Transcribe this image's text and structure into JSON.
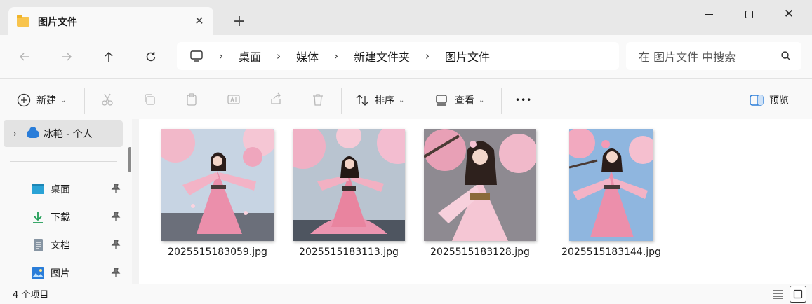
{
  "window": {
    "tab_title": "图片文件",
    "tab_close": "✕",
    "new_tab": "+",
    "minimize": "minimize-icon",
    "maximize": "maximize-icon",
    "close": "✕"
  },
  "nav": {
    "back": "back-arrow-icon",
    "forward": "forward-arrow-icon",
    "up": "up-arrow-icon",
    "refresh": "refresh-icon"
  },
  "address": {
    "breadcrumbs": [
      "桌面",
      "媒体",
      "新建文件夹",
      "图片文件"
    ],
    "chevron": "›"
  },
  "search": {
    "placeholder": "在 图片文件 中搜索"
  },
  "toolbar": {
    "new_label": "新建",
    "sort_label": "排序",
    "view_label": "查看",
    "more_label": "•••",
    "preview_label": "预览",
    "dropdown_glyph": "⌄"
  },
  "sidebar": {
    "onedrive": {
      "arrow": "›",
      "label": "冰艳 - 个人"
    },
    "items": [
      {
        "label": "桌面",
        "icon": "desktop-icon",
        "color": "#2aa3d6"
      },
      {
        "label": "下载",
        "icon": "download-icon",
        "color": "#1f9d55"
      },
      {
        "label": "文档",
        "icon": "document-icon",
        "color": "#6b7b8c"
      },
      {
        "label": "图片",
        "icon": "pictures-icon",
        "color": "#2a7dd9"
      }
    ]
  },
  "files": [
    {
      "name": "2025515183059.jpg"
    },
    {
      "name": "2025515183113.jpg"
    },
    {
      "name": "2025515183128.jpg"
    },
    {
      "name": "2025515183144.jpg"
    }
  ],
  "status": {
    "count": "4 个项目"
  },
  "colors": {
    "accent": "#2a7dd9",
    "folder": "#f8c44d",
    "blossom": "#f2a6bd",
    "dress": "#eb8fab"
  }
}
